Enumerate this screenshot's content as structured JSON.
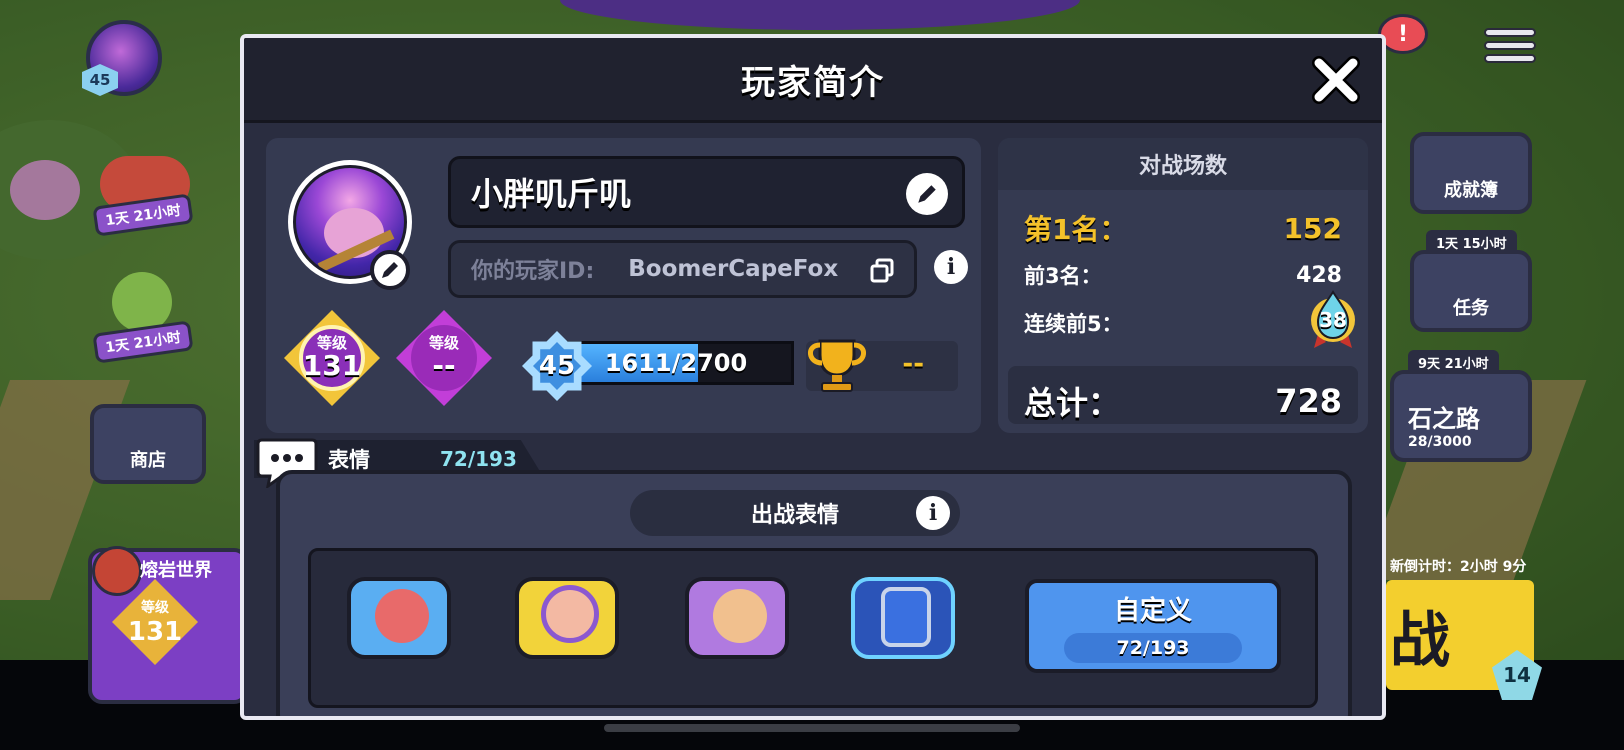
{
  "background": {
    "player_level_chip": "45",
    "side_left": [
      {
        "label": "1天 21小时"
      },
      {
        "label": "1天 21小时"
      },
      {
        "label": "商店"
      }
    ],
    "lava_world": "熔岩世界",
    "lava_level_caption": "等级",
    "lava_level_value": "131",
    "side_right": [
      {
        "label": "成就簿"
      },
      {
        "timer": "1天 15小时",
        "label": "任务"
      },
      {
        "timer": "9天 21小时",
        "label": "石之路",
        "progress": "28/3000"
      }
    ],
    "countdown": "新倒计时：2小时 9分",
    "battle_glyph": "战",
    "bottom_badge": "14",
    "notif_badge": "!"
  },
  "modal": {
    "title": "玩家简介",
    "player_name": "小胖叽斤叽",
    "id_label": "你的玩家ID:",
    "id_value": "BoomerCapeFox",
    "level_badge": {
      "caption": "等级",
      "value": "131"
    },
    "rank_badge": {
      "caption": "等级",
      "value": "--"
    },
    "xp": {
      "level": "45",
      "text": "1611/2700",
      "current": 1611,
      "max": 2700
    },
    "trophy_value": "--",
    "stats": {
      "header": "对战场数",
      "first_label": "第1名：",
      "first_value": "152",
      "top3_label": "前3名：",
      "top3_value": "428",
      "streak_label": "连续前5：",
      "streak_value": "38",
      "total_label": "总计：",
      "total_value": "728"
    },
    "emotes": {
      "tab_label": "表情",
      "tab_count": "72/193",
      "subheader": "出战表情",
      "custom_title": "自定义",
      "custom_count": "72/193"
    }
  },
  "colors": {
    "gold": "#f4c22a",
    "xp_blue": "#3e8fe0",
    "panel": "#353a51",
    "modal_bg": "#2a2d40"
  }
}
